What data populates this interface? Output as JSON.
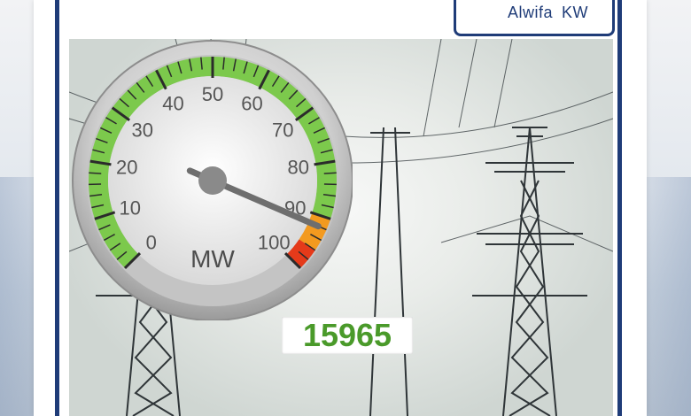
{
  "logo": {
    "name": "Alwifa",
    "suffix": "KW"
  },
  "gauge": {
    "unit": "MW",
    "min": 0,
    "max": 100,
    "ticks": [
      "0",
      "10",
      "20",
      "30",
      "40",
      "50",
      "60",
      "70",
      "80",
      "90",
      "100"
    ],
    "needle_value": 92,
    "reading": "15965",
    "colors": {
      "green_band": "#7cc94c",
      "red_band": "#e53a1a",
      "orange_band": "#f39a1f",
      "reading_text": "#4a9a2a",
      "frame": "#1f3c78"
    }
  }
}
